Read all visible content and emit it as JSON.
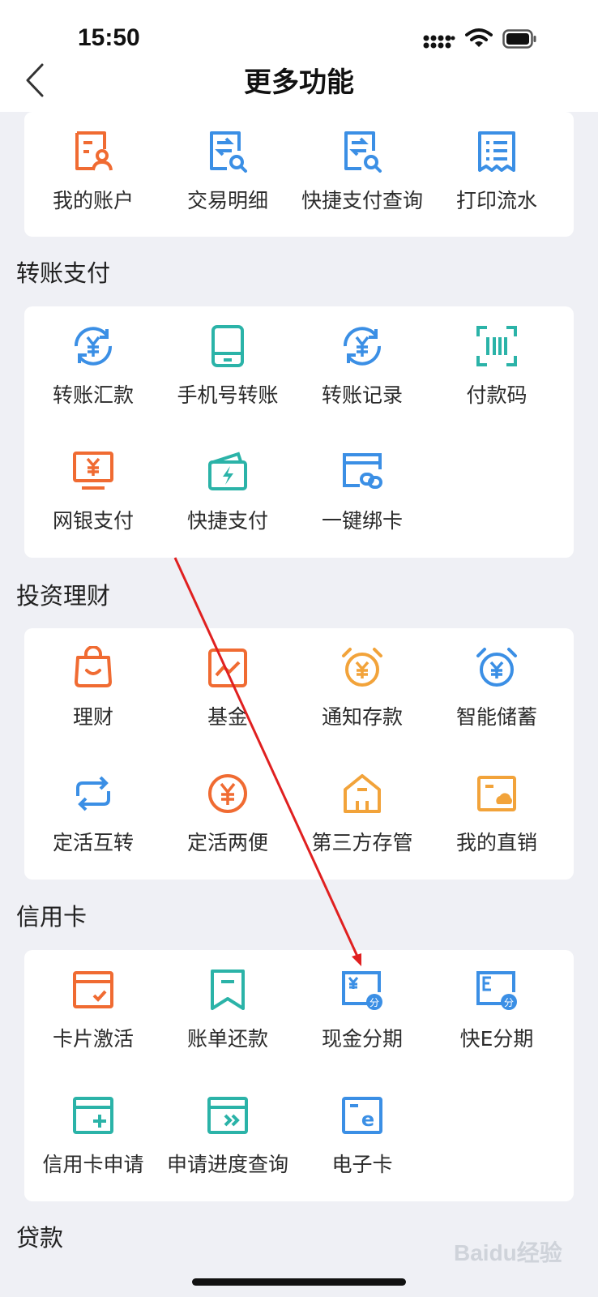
{
  "status_bar": {
    "time": "15:50"
  },
  "header": {
    "title": "更多功能"
  },
  "colors": {
    "orange": "#f06b32",
    "blue": "#3b8fe5",
    "teal": "#2bb3a8",
    "amber": "#f2a33a",
    "arrow": "#e02020"
  },
  "sections": [
    {
      "title": "",
      "items": [
        {
          "label": "我的账户",
          "icon": "account-icon"
        },
        {
          "label": "交易明细",
          "icon": "transaction-detail-icon"
        },
        {
          "label": "快捷支付查询",
          "icon": "quick-pay-query-icon"
        },
        {
          "label": "打印流水",
          "icon": "print-statement-icon"
        }
      ]
    },
    {
      "title": "转账支付",
      "items": [
        {
          "label": "转账汇款",
          "icon": "transfer-icon"
        },
        {
          "label": "手机号转账",
          "icon": "phone-transfer-icon"
        },
        {
          "label": "转账记录",
          "icon": "transfer-record-icon"
        },
        {
          "label": "付款码",
          "icon": "payment-code-icon"
        },
        {
          "label": "网银支付",
          "icon": "online-banking-icon"
        },
        {
          "label": "快捷支付",
          "icon": "quick-pay-icon"
        },
        {
          "label": "一键绑卡",
          "icon": "bind-card-icon"
        }
      ]
    },
    {
      "title": "投资理财",
      "items": [
        {
          "label": "理财",
          "icon": "wealth-bag-icon"
        },
        {
          "label": "基金",
          "icon": "fund-chart-icon"
        },
        {
          "label": "通知存款",
          "icon": "notice-deposit-icon"
        },
        {
          "label": "智能储蓄",
          "icon": "smart-savings-icon"
        },
        {
          "label": "定活互转",
          "icon": "fixed-current-switch-icon"
        },
        {
          "label": "定活两便",
          "icon": "fixed-current-icon"
        },
        {
          "label": "第三方存管",
          "icon": "third-party-custody-icon"
        },
        {
          "label": "我的直销",
          "icon": "direct-sales-icon"
        }
      ]
    },
    {
      "title": "信用卡",
      "items": [
        {
          "label": "卡片激活",
          "icon": "card-activate-icon"
        },
        {
          "label": "账单还款",
          "icon": "bill-repay-icon"
        },
        {
          "label": "现金分期",
          "icon": "cash-installment-icon"
        },
        {
          "label": "快E分期",
          "icon": "quick-e-installment-icon"
        },
        {
          "label": "信用卡申请",
          "icon": "card-apply-icon"
        },
        {
          "label": "申请进度查询",
          "icon": "apply-progress-icon"
        },
        {
          "label": "电子卡",
          "icon": "e-card-icon"
        }
      ]
    },
    {
      "title": "贷款",
      "items": []
    }
  ],
  "watermark": "Baidu经验"
}
